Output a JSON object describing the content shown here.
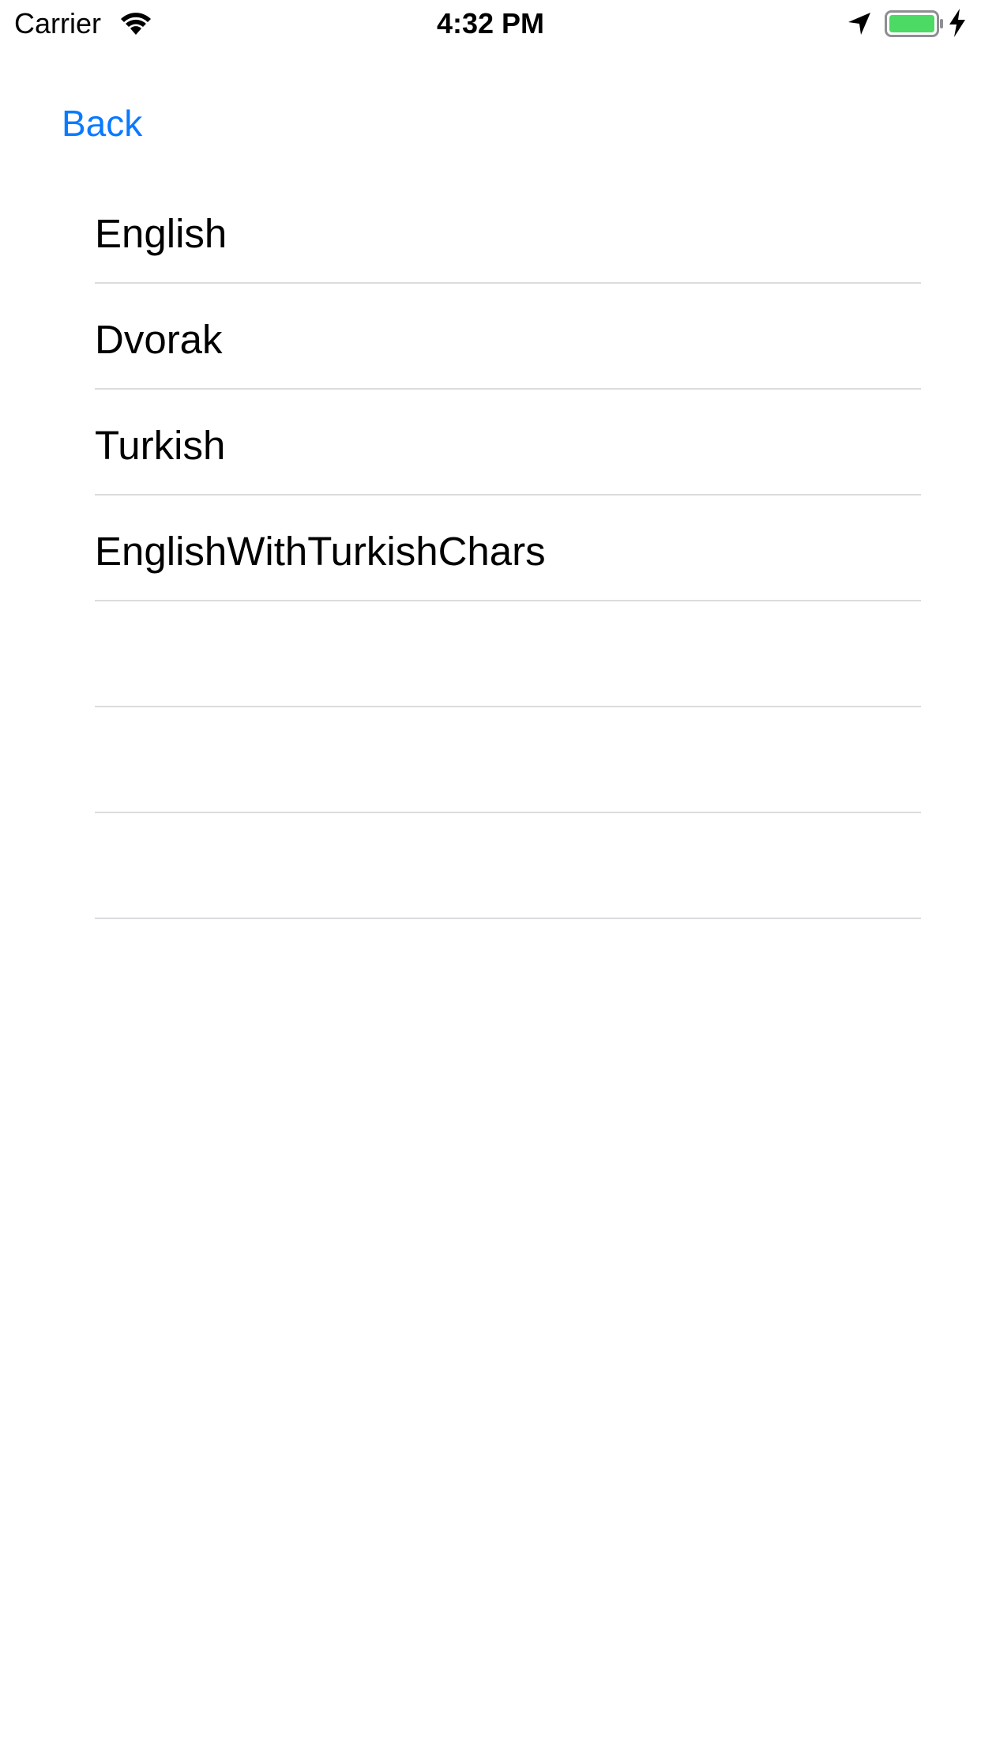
{
  "status_bar": {
    "carrier": "Carrier",
    "time": "4:32 PM",
    "battery_color": "#4cd964",
    "icons": [
      "wifi-icon",
      "location-icon",
      "battery-icon",
      "charging-icon"
    ]
  },
  "nav": {
    "back_label": "Back",
    "accent_color": "#0a7aff"
  },
  "layouts": [
    {
      "label": "English"
    },
    {
      "label": "Dvorak"
    },
    {
      "label": "Turkish"
    },
    {
      "label": "EnglishWithTurkishChars"
    },
    {
      "label": ""
    },
    {
      "label": ""
    },
    {
      "label": ""
    }
  ]
}
